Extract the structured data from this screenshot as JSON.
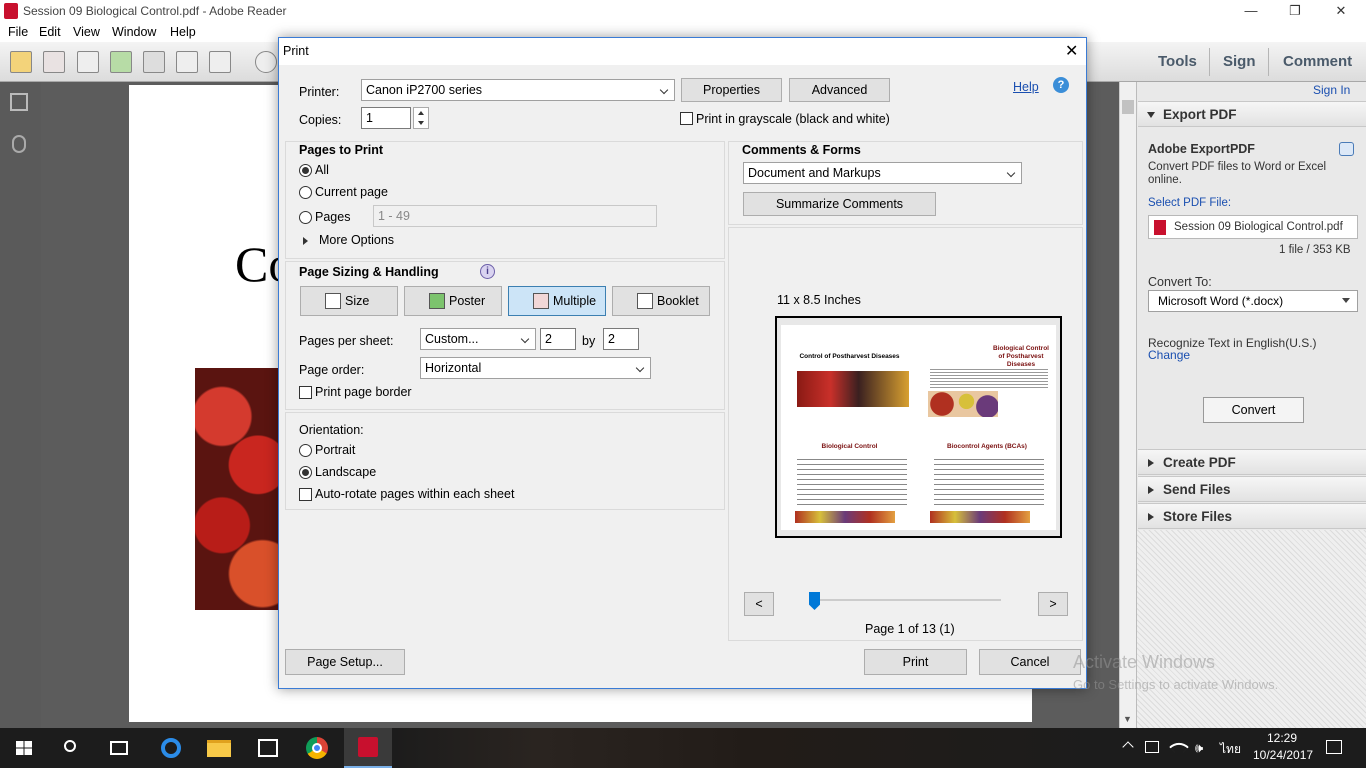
{
  "window": {
    "title": "Session 09 Biological Control.pdf - Adobe Reader"
  },
  "menu": [
    "File",
    "Edit",
    "View",
    "Window",
    "Help"
  ],
  "toolbar": {
    "tools": "Tools",
    "sign": "Sign",
    "comment": "Comment",
    "signin": "Sign In"
  },
  "document": {
    "heading_fragment": "Co"
  },
  "right_pane": {
    "export_header": "Export PDF",
    "service_title": "Adobe ExportPDF",
    "service_desc": "Convert PDF files to Word or Excel online.",
    "select_label": "Select PDF File:",
    "file_name": "Session 09 Biological Control.pdf",
    "file_info": "1 file / 353 KB",
    "convert_to_label": "Convert To:",
    "convert_to_value": "Microsoft Word (*.docx)",
    "recognize_text": "Recognize Text in English(U.S.)",
    "change_link": "Change",
    "convert_button": "Convert",
    "sections": [
      "Create PDF",
      "Send Files",
      "Store Files"
    ]
  },
  "dialog": {
    "title": "Print",
    "printer_label": "Printer:",
    "printer_value": "Canon iP2700 series",
    "properties": "Properties",
    "advanced": "Advanced",
    "help": "Help",
    "copies_label": "Copies:",
    "copies_value": "1",
    "grayscale": "Print in grayscale (black and white)",
    "pages_to_print": {
      "title": "Pages to Print",
      "all": "All",
      "current": "Current page",
      "pages": "Pages",
      "pages_placeholder": "1 - 49",
      "more_options": "More Options"
    },
    "sizing": {
      "title": "Page Sizing & Handling",
      "size": "Size",
      "poster": "Poster",
      "multiple": "Multiple",
      "booklet": "Booklet",
      "pages_per_sheet_label": "Pages per sheet:",
      "pages_per_sheet_value": "Custom...",
      "cols": "2",
      "by": "by",
      "rows": "2",
      "page_order_label": "Page order:",
      "page_order_value": "Horizontal",
      "border": "Print page border"
    },
    "orientation": {
      "title": "Orientation:",
      "portrait": "Portrait",
      "landscape": "Landscape",
      "autorotate": "Auto-rotate pages within each sheet"
    },
    "comments": {
      "title": "Comments & Forms",
      "value": "Document and Markups",
      "summarize": "Summarize Comments"
    },
    "preview": {
      "size": "11 x 8.5 Inches",
      "slide1": "Control of Postharvest Diseases",
      "slide2": "Biological Control of Postharvest Diseases",
      "slide3": "Biological Control",
      "slide4": "Biocontrol Agents (BCAs)",
      "page_status": "Page 1 of 13 (1)",
      "prev": "<",
      "next": ">",
      "slider_fraction": 0.0
    },
    "page_setup": "Page Setup...",
    "print": "Print",
    "cancel": "Cancel"
  },
  "watermark": {
    "line1": "Activate Windows",
    "line2": "Go to Settings to activate Windows."
  },
  "taskbar": {
    "time": "12:29",
    "date": "10/24/2017",
    "lang": "ไทย"
  }
}
